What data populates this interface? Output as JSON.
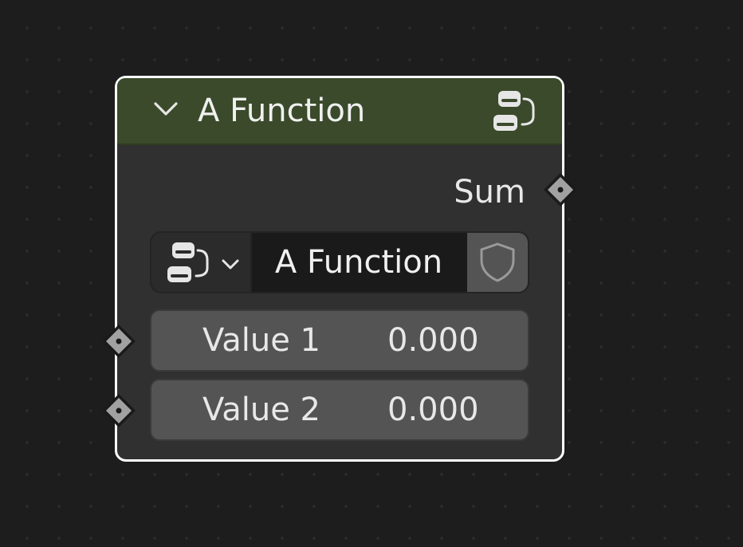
{
  "node": {
    "title": "A Function",
    "header_color": "#3a4a2b",
    "header_icon": "node-tree-icon",
    "collapse_icon": "chevron-down-icon"
  },
  "outputs": [
    {
      "label": "Sum",
      "socket_color": "#a1a1a1"
    }
  ],
  "group_selector": {
    "type_icon": "node-tree-icon",
    "dropdown_icon": "chevron-down-icon",
    "name": "A Function",
    "fake_user_icon": "shield-icon"
  },
  "inputs": [
    {
      "label": "Value 1",
      "value": "0.000",
      "socket_color": "#a1a1a1"
    },
    {
      "label": "Value 2",
      "value": "0.000",
      "socket_color": "#a1a1a1"
    }
  ],
  "colors": {
    "canvas": "#1d1d1d",
    "node_body": "#303030",
    "node_outline_selected": "#ffffff",
    "field": "#545454",
    "text": "#e8e8e8"
  }
}
